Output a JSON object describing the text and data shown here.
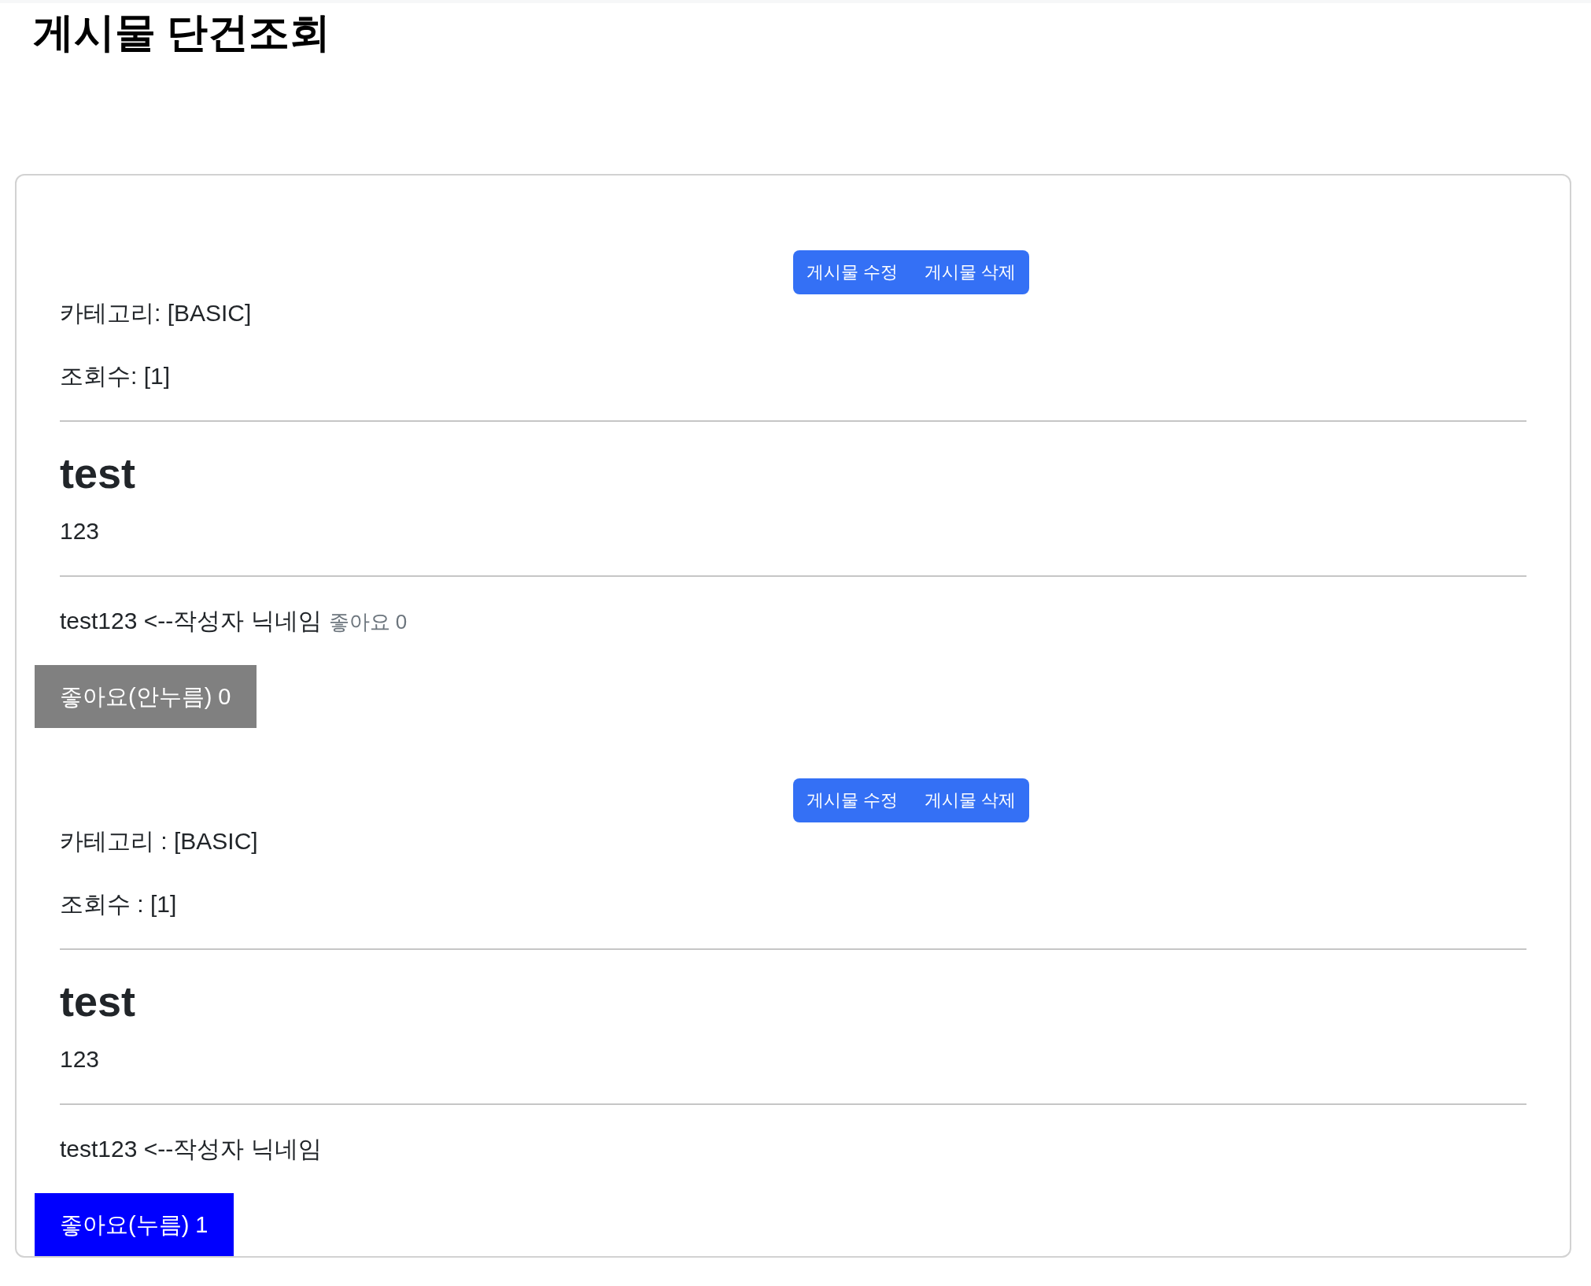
{
  "header": {
    "title": "게시물 단건조회"
  },
  "posts": [
    {
      "actions": [
        "게시물 수정",
        "게시물 삭제"
      ],
      "category": "카테고리: [BASIC]",
      "views": "조회수: [1]",
      "title": "test",
      "body": "123",
      "author": "test123 <--작성자 닉네임",
      "like_count": "좋아요 0",
      "like_button": {
        "label": "좋아요(안누름) 0",
        "pressed": false
      }
    },
    {
      "actions": [
        "게시물 수정",
        "게시물 삭제"
      ],
      "category": "카테고리 : [BASIC]",
      "views": "조회수 : [1]",
      "title": "test",
      "body": "123",
      "author": "test123 <--작성자 닉네임",
      "like_button": {
        "label": "좋아요(누름) 1",
        "pressed": true
      }
    }
  ]
}
